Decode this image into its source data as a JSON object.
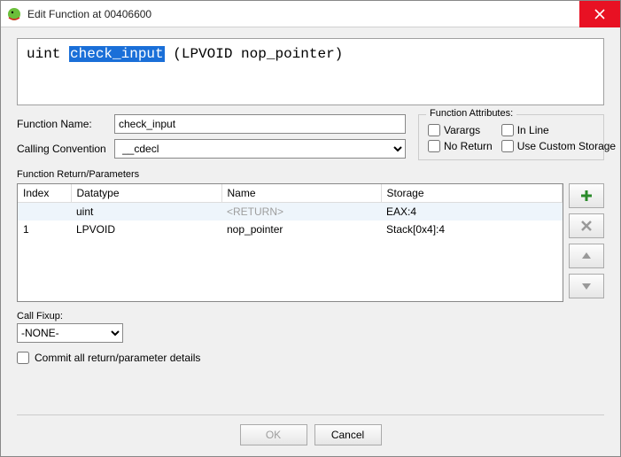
{
  "window": {
    "title": "Edit Function at 00406600"
  },
  "signature": {
    "ret": "uint",
    "name": "check_input",
    "params_open": " (",
    "p1_type": "LPVOID",
    "p1_name": " nop_pointer",
    "params_close": ")"
  },
  "form": {
    "fn_label": "Function Name:",
    "fn_value": "check_input",
    "cc_label": "Calling Convention",
    "cc_value": "__cdecl"
  },
  "attrs": {
    "group": "Function Attributes:",
    "varargs": "Varargs",
    "inline": "In Line",
    "noreturn": "No Return",
    "custom": "Use Custom Storage"
  },
  "params": {
    "label": "Function Return/Parameters",
    "cols": {
      "index": "Index",
      "datatype": "Datatype",
      "name": "Name",
      "storage": "Storage"
    },
    "rows": [
      {
        "index": "",
        "datatype": "uint",
        "name": "<RETURN>",
        "storage": "EAX:4",
        "is_return": true
      },
      {
        "index": "1",
        "datatype": "LPVOID",
        "name": "nop_pointer",
        "storage": "Stack[0x4]:4",
        "is_return": false
      }
    ]
  },
  "fixup": {
    "label": "Call Fixup:",
    "value": "-NONE-"
  },
  "commit": {
    "label": "Commit all return/parameter details"
  },
  "buttons": {
    "ok": "OK",
    "cancel": "Cancel"
  }
}
